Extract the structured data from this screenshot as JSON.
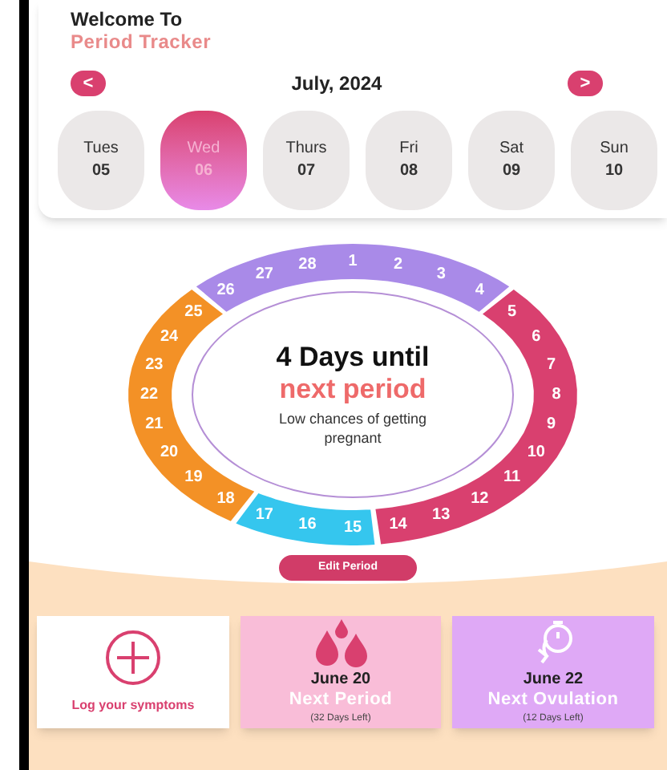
{
  "header": {
    "title": "Welcome To",
    "subtitle": "Period Tracker"
  },
  "calendar": {
    "prev": "<",
    "month": "July, 2024",
    "next": ">",
    "days": [
      {
        "weekday": "Tues",
        "date": "05",
        "selected": false
      },
      {
        "weekday": "Wed",
        "date": "06",
        "selected": true
      },
      {
        "weekday": "Thurs",
        "date": "07",
        "selected": false
      },
      {
        "weekday": "Fri",
        "date": "08",
        "selected": false
      },
      {
        "weekday": "Sat",
        "date": "09",
        "selected": false
      },
      {
        "weekday": "Sun",
        "date": "10",
        "selected": false
      }
    ]
  },
  "cycle": {
    "segments": [
      {
        "color": "#a98ae8",
        "days": [
          "26",
          "27",
          "28",
          "1",
          "2",
          "3",
          "4"
        ]
      },
      {
        "color": "#f39126",
        "days": [
          "25",
          "24",
          "23",
          "22",
          "21",
          "20",
          "19",
          "18"
        ]
      },
      {
        "color": "#35c6ee",
        "days": [
          "17",
          "16",
          "15"
        ]
      },
      {
        "color": "#d9406f",
        "days": [
          "5",
          "6",
          "7",
          "8",
          "9",
          "10",
          "11",
          "12",
          "13",
          "14"
        ]
      }
    ],
    "headline": "4 Days until",
    "highlight": "next period",
    "note": "Low chances of getting pregnant"
  },
  "edit_button": "Edit Period",
  "cards": [
    {
      "kind": "log",
      "label": "Log your symptoms"
    },
    {
      "kind": "period",
      "date": "June 20",
      "title": "Next Period",
      "remaining": "(32 Days Left)"
    },
    {
      "kind": "ovulation",
      "date": "June 22",
      "title": "Next Ovulation",
      "remaining": "(12 Days Left)"
    }
  ]
}
